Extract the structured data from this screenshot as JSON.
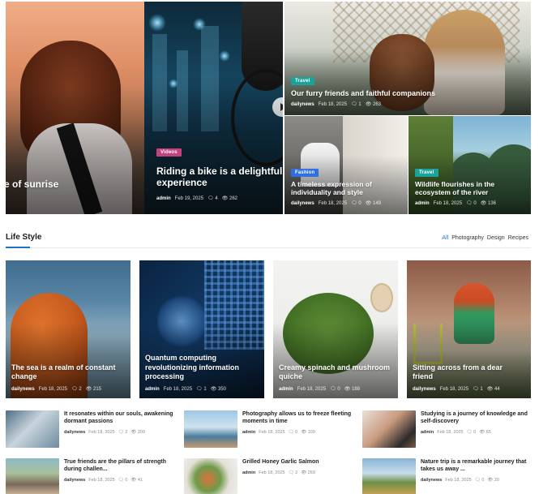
{
  "hero": {
    "tile1": {
      "title": "e of sunrise"
    },
    "tile2": {
      "category": "Videos",
      "title": "Riding a bike is a delightful experience",
      "author": "admin",
      "date": "Feb 19, 2025",
      "comments": "4",
      "views": "262"
    },
    "tile3": {
      "category": "Travel",
      "title": "Our furry friends and faithful companions",
      "author": "dailynews",
      "date": "Feb 18, 2025",
      "comments": "1",
      "views": "263"
    },
    "tile4": {
      "category": "Fashion",
      "title": "A timeless expression of individuality and style",
      "author": "dailynews",
      "date": "Feb 18, 2025",
      "comments": "0",
      "views": "149"
    },
    "tile5": {
      "category": "Travel",
      "title": "Wildlife flourishes in the ecosystem of the river",
      "author": "admin",
      "date": "Feb 18, 2025",
      "comments": "0",
      "views": "136"
    }
  },
  "section": {
    "title": "Life Style",
    "filters": [
      "All",
      "Photography",
      "Design",
      "Recipes"
    ]
  },
  "cards": [
    {
      "title": "The sea is a realm of constant change",
      "author": "dailynews",
      "date": "Feb 18, 2025",
      "comments": "2",
      "views": "215"
    },
    {
      "title": "Quantum computing revolutionizing information processing",
      "author": "admin",
      "date": "Feb 18, 2025",
      "comments": "1",
      "views": "350"
    },
    {
      "title": "Creamy spinach and mushroom quiche",
      "author": "admin",
      "date": "Feb 18, 2025",
      "comments": "0",
      "views": "188"
    },
    {
      "title": "Sitting across from a dear friend",
      "author": "dailynews",
      "date": "Feb 18, 2025",
      "comments": "1",
      "views": "44"
    }
  ],
  "list": [
    {
      "title": "It resonates within our souls, awakening dormant passions",
      "author": "dailynews",
      "date": "Feb 18, 2025",
      "comments": "2",
      "views": "209"
    },
    {
      "title": "Photography allows us to freeze fleeting moments in time",
      "author": "admin",
      "date": "Feb 18, 2025",
      "comments": "0",
      "views": "109"
    },
    {
      "title": "Studying is a journey of knowledge and self-discovery",
      "author": "admin",
      "date": "Feb 18, 2025",
      "comments": "0",
      "views": "65"
    },
    {
      "title": "True friends are the pillars of strength during challen...",
      "author": "dailynews",
      "date": "Feb 18, 2025",
      "comments": "0",
      "views": "41"
    },
    {
      "title": "Grilled Honey Garlic Salmon",
      "author": "admin",
      "date": "Feb 18, 2025",
      "comments": "2",
      "views": "269"
    },
    {
      "title": "Nature trip is a remarkable journey that takes us away ...",
      "author": "dailynews",
      "date": "Feb 18, 2025",
      "comments": "0",
      "views": "20"
    }
  ],
  "icons": {
    "comment": "comment-icon",
    "views": "eye-icon"
  }
}
